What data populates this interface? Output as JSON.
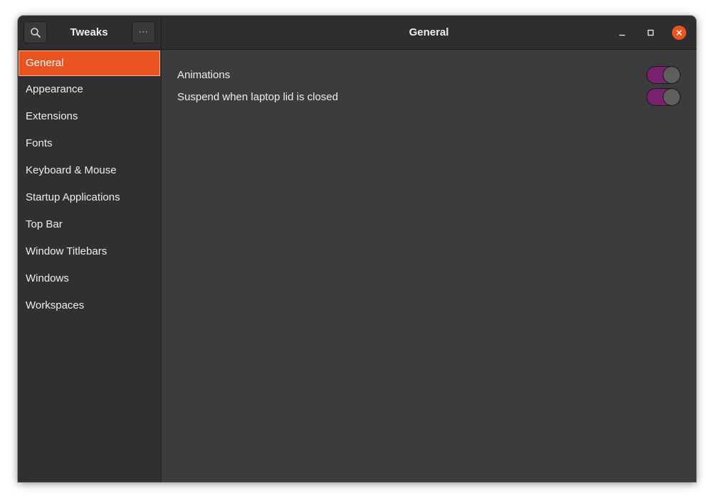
{
  "app": {
    "title": "Tweaks"
  },
  "header": {
    "page_title": "General"
  },
  "icons": {
    "search": "search-icon",
    "menu": "more-horizontal-icon",
    "menu_glyph": "···",
    "minimize": "minimize-icon",
    "maximize": "maximize-icon",
    "close": "close-icon"
  },
  "sidebar": {
    "items": [
      {
        "label": "General",
        "selected": true
      },
      {
        "label": "Appearance"
      },
      {
        "label": "Extensions"
      },
      {
        "label": "Fonts"
      },
      {
        "label": "Keyboard & Mouse"
      },
      {
        "label": "Startup Applications"
      },
      {
        "label": "Top Bar"
      },
      {
        "label": "Window Titlebars"
      },
      {
        "label": "Windows"
      },
      {
        "label": "Workspaces"
      }
    ]
  },
  "settings": {
    "rows": [
      {
        "label": "Animations",
        "enabled": true
      },
      {
        "label": "Suspend when laptop lid is closed",
        "enabled": true
      }
    ]
  },
  "colors": {
    "accent": "#e95420",
    "switch_on": "#77216f",
    "headerbar": "#2e2e2e",
    "sidebar": "#303030",
    "content": "#3c3c3c"
  }
}
